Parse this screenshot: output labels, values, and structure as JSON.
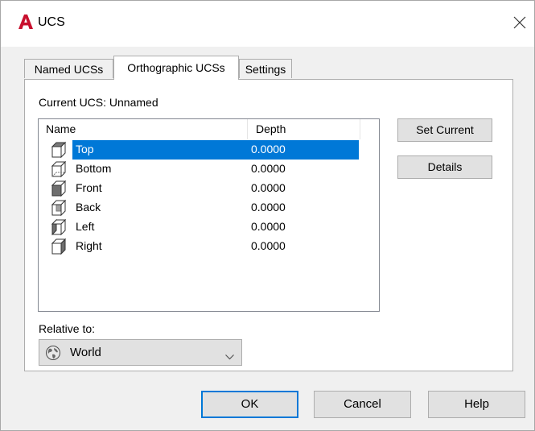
{
  "window": {
    "title": "UCS",
    "app_icon": "autocad-logo-icon",
    "close_icon": "close-icon"
  },
  "tabs": [
    {
      "label": "Named UCSs",
      "active": false
    },
    {
      "label": "Orthographic UCSs",
      "active": true
    },
    {
      "label": "Settings",
      "active": false
    }
  ],
  "panel": {
    "current_ucs": "Current UCS:  Unnamed",
    "list": {
      "columns": [
        "Name",
        "Depth"
      ],
      "rows": [
        {
          "name": "Top",
          "depth": "0.0000",
          "selected": true,
          "icon": "ucs-top-icon"
        },
        {
          "name": "Bottom",
          "depth": "0.0000",
          "selected": false,
          "icon": "ucs-bottom-icon"
        },
        {
          "name": "Front",
          "depth": "0.0000",
          "selected": false,
          "icon": "ucs-front-icon"
        },
        {
          "name": "Back",
          "depth": "0.0000",
          "selected": false,
          "icon": "ucs-back-icon"
        },
        {
          "name": "Left",
          "depth": "0.0000",
          "selected": false,
          "icon": "ucs-left-icon"
        },
        {
          "name": "Right",
          "depth": "0.0000",
          "selected": false,
          "icon": "ucs-right-icon"
        }
      ]
    },
    "set_current_label": "Set Current",
    "details_label": "Details",
    "relative_to_label": "Relative to:",
    "relative_to_value": "World",
    "relative_to_icon": "globe-icon"
  },
  "footer": {
    "ok_label": "OK",
    "cancel_label": "Cancel",
    "help_label": "Help"
  },
  "colors": {
    "selection": "#0078d7",
    "logo_red": "#c8102e"
  }
}
